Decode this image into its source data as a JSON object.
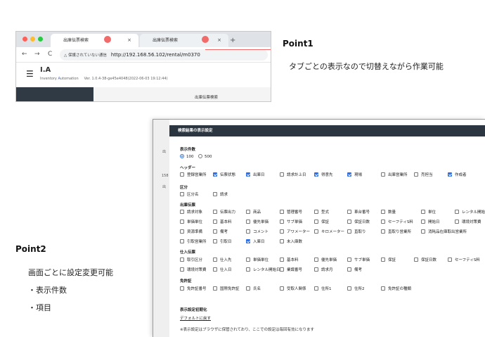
{
  "browser": {
    "tab_active_title": "出庫伝票検索",
    "tab_inactive_title": "出庫伝票検索",
    "tab_close": "×",
    "new_tab": "+",
    "nav_back": "←",
    "nav_forward": "→",
    "nav_reload": "C",
    "security_warning": "△ 保護されていない通信",
    "url": "http://192.168.56.102/rental/m0370",
    "app_title": "I.A",
    "app_subtitle_prefix": "Inventory ",
    "app_subtitle_highlight": "A",
    "app_subtitle_suffix": "utomation",
    "app_version": "Ver. 1.0.4-38-ge45e4048(2022-06-03 19:12:44)",
    "page_label": "出庫伝票検索"
  },
  "annotations": {
    "point1_title": "Point1",
    "point1_text": "タブごとの表示なので切替えながら作業可能",
    "point2_title": "Point2",
    "point2_text": "画面ごとに設定変更可能",
    "point2_bullet1": "・表示件数",
    "point2_bullet2": "・項目"
  },
  "dialog": {
    "title": "検索結果の表示設定",
    "bg_labels": [
      "出",
      "158",
      "出"
    ],
    "count_label": "表示件数",
    "count_options": [
      {
        "label": "100",
        "selected": true
      },
      {
        "label": "500",
        "selected": false
      }
    ],
    "header_label": "ヘッダー",
    "header_items": [
      {
        "label": "登録営業所",
        "checked": false
      },
      {
        "label": "伝票状態",
        "checked": true
      },
      {
        "label": "出庫日",
        "checked": true
      },
      {
        "label": "請求計上日",
        "checked": false
      },
      {
        "label": "得意先",
        "checked": true
      },
      {
        "label": "現場",
        "checked": true
      },
      {
        "label": "出庫営業所",
        "checked": false
      },
      {
        "label": "売担当",
        "checked": false
      },
      {
        "label": "作成者",
        "checked": true
      }
    ],
    "category_label": "区分",
    "category_items": [
      {
        "label": "区分名",
        "checked": false
      },
      {
        "label": "請求",
        "checked": false
      }
    ],
    "shipping_label": "出庫伝票",
    "shipping_rows": [
      [
        {
          "label": "請求対象",
          "checked": false
        },
        {
          "label": "伝票出力",
          "checked": false
        },
        {
          "label": "商品",
          "checked": false
        },
        {
          "label": "管理番号",
          "checked": false
        },
        {
          "label": "型式",
          "checked": false
        },
        {
          "label": "車台番号",
          "checked": false
        },
        {
          "label": "数量",
          "checked": false
        },
        {
          "label": "単位",
          "checked": false
        },
        {
          "label": "レンタル開始日",
          "checked": false
        }
      ],
      [
        {
          "label": "単価単位",
          "checked": false
        },
        {
          "label": "基本料",
          "checked": false
        },
        {
          "label": "優先単価",
          "checked": false
        },
        {
          "label": "サブ単価",
          "checked": false
        },
        {
          "label": "保証",
          "checked": false
        },
        {
          "label": "保証日数",
          "checked": false
        },
        {
          "label": "セーフティS料",
          "checked": false
        },
        {
          "label": "開始日",
          "checked": false
        },
        {
          "label": "環境対策費",
          "checked": false
        }
      ],
      [
        {
          "label": "資源準備",
          "checked": false
        },
        {
          "label": "備考",
          "checked": false
        },
        {
          "label": "コメント",
          "checked": false
        },
        {
          "label": "アワメーター",
          "checked": false
        },
        {
          "label": "キロメーター",
          "checked": false
        },
        {
          "label": "直取り",
          "checked": false
        },
        {
          "label": "直取り営業所",
          "checked": false
        },
        {
          "label": "消耗品在庫取出営業所",
          "checked": false
        }
      ],
      [
        {
          "label": "引取営業所",
          "checked": false
        },
        {
          "label": "引取日",
          "checked": false
        },
        {
          "label": "入庫日",
          "checked": true
        },
        {
          "label": "未入庫数",
          "checked": false
        }
      ]
    ],
    "purchase_label": "仕入伝票",
    "purchase_rows": [
      [
        {
          "label": "取引区分",
          "checked": false
        },
        {
          "label": "仕入先",
          "checked": false
        },
        {
          "label": "単価単位",
          "checked": false
        },
        {
          "label": "基本料",
          "checked": false
        },
        {
          "label": "優先単価",
          "checked": false
        },
        {
          "label": "サブ単価",
          "checked": false
        },
        {
          "label": "保証",
          "checked": false
        },
        {
          "label": "保証日数",
          "checked": false
        },
        {
          "label": "セーフティS料",
          "checked": false
        }
      ],
      [
        {
          "label": "環境対策費",
          "checked": false
        },
        {
          "label": "仕入日",
          "checked": false
        },
        {
          "label": "レンタル開始日",
          "checked": false
        },
        {
          "label": "業識番号",
          "checked": false
        },
        {
          "label": "請求月",
          "checked": false
        },
        {
          "label": "備考",
          "checked": false
        }
      ]
    ],
    "license_label": "免許証",
    "license_items": [
      {
        "label": "免許証番号",
        "checked": false
      },
      {
        "label": "国際免許証",
        "checked": false
      },
      {
        "label": "氏名",
        "checked": false
      },
      {
        "label": "受取人関係",
        "checked": false
      },
      {
        "label": "住所1",
        "checked": false
      },
      {
        "label": "住所2",
        "checked": false
      },
      {
        "label": "免許証の種類",
        "checked": false
      }
    ],
    "init_label": "表示設定初期化",
    "reset_link": "デフォルトに戻す",
    "footer_note": "※表示設定はブラウザに保管されており、ここでの設定は毎回有効になります"
  },
  "colors": {
    "pointer": "#f26b6b",
    "checkbox_on": "#2f6fe4",
    "dialog_header": "#2c3640"
  }
}
